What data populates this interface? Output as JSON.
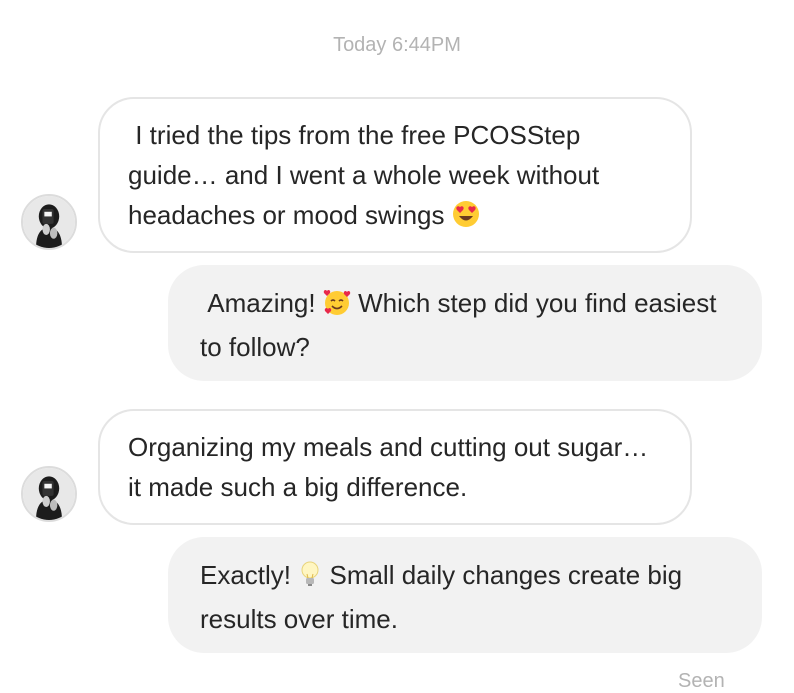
{
  "conversation": {
    "timestamp": "Today 6:44PM",
    "messages": [
      {
        "direction": "incoming",
        "text_before": " I tried the tips from the free PCOSStep guide… and I went a whole week without headaches or mood swings ",
        "emoji": "heart-eyes-emoji",
        "text_after": ""
      },
      {
        "direction": "outgoing",
        "text_before": " Amazing! ",
        "emoji": "smiling-face-with-hearts-emoji",
        "text_after": " Which step did you find easiest to follow?"
      },
      {
        "direction": "incoming",
        "text_before": "Organizing my meals and cutting out sugar… it made such a big difference.",
        "emoji": "",
        "text_after": ""
      },
      {
        "direction": "outgoing",
        "text_before": "Exactly! ",
        "emoji": "light-bulb-emoji",
        "text_after": " Small daily changes create big results over time."
      }
    ],
    "status": "Seen"
  },
  "colors": {
    "background": "#ffffff",
    "incoming_bubble_border": "#e5e5e5",
    "outgoing_bubble_bg": "#f2f2f2",
    "meta_text": "#b3b3b3",
    "text": "#262626"
  }
}
